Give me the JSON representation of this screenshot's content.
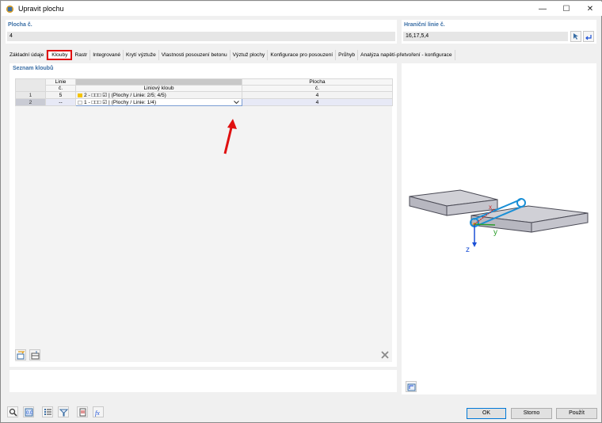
{
  "window": {
    "title": "Upravit plochu",
    "controls": {
      "minimize": "—",
      "maximize": "☐",
      "close": "✕"
    }
  },
  "surface_no": {
    "label": "Plocha č.",
    "value": "4"
  },
  "boundary_lines": {
    "label": "Hraniční linie č.",
    "value": "16,17,5,4"
  },
  "tabs": [
    {
      "label": "Základní údaje"
    },
    {
      "label": "Klouby",
      "active": true
    },
    {
      "label": "Rastr"
    },
    {
      "label": "Integrované"
    },
    {
      "label": "Krytí výztuže"
    },
    {
      "label": "Vlastnosti posouzení betonu"
    },
    {
      "label": "Výztuž plochy"
    },
    {
      "label": "Konfigurace pro posouzení"
    },
    {
      "label": "Průhyb"
    },
    {
      "label": "Analýza napětí-přetvoření - konfigurace"
    }
  ],
  "hinge_list": {
    "title": "Seznam kloubů",
    "columns": {
      "line": [
        "Linie",
        "č."
      ],
      "hinge": "Liniový kloub",
      "surface": [
        "Plocha",
        "č."
      ]
    },
    "rows": [
      {
        "num": "1",
        "line": "5",
        "hinge": "2 - □□□ ☑ | (Plochy / Linie: 2/5; 4/5)",
        "surface": "4",
        "color": "#f5c400"
      },
      {
        "num": "2",
        "line": "--",
        "hinge": "1 - □□□ ☑ | (Plochy / Linie: 1/4)",
        "surface": "4",
        "color": "#ffffff"
      }
    ]
  },
  "preview_axes": {
    "x": "x",
    "y": "y",
    "z": "z"
  },
  "buttons": {
    "ok": "OK",
    "cancel": "Storno",
    "apply": "Použít"
  },
  "colors": {
    "group_label": "#3a6ea5",
    "highlight": "#e01010",
    "axis_z": "#1a4fd6",
    "axis_y": "#2a9d2a",
    "axis_x": "#c62828"
  }
}
